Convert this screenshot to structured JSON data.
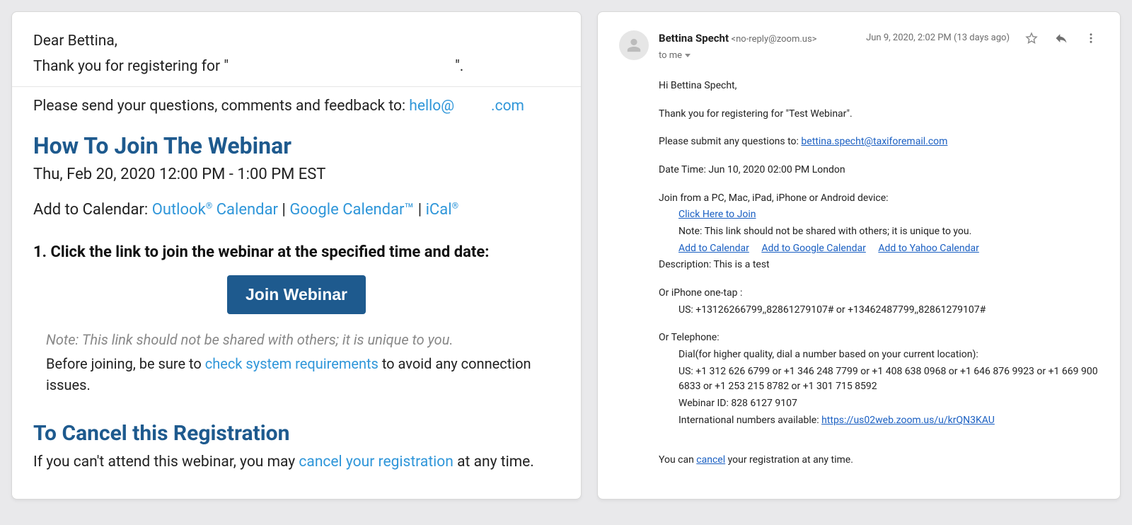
{
  "left": {
    "greeting": "Dear Bettina,",
    "thank_you_prefix": "Thank you for registering for \"",
    "thank_you_suffix": "\".",
    "feedback_label": "Please send your questions, comments and feedback to: ",
    "feedback_email_visible_prefix": "hello@",
    "feedback_email_visible_suffix": ".com",
    "section_join_title": "How To Join The Webinar",
    "datetime": "Thu, Feb 20, 2020 12:00 PM - 1:00 PM EST",
    "add_to_calendar_label": "Add to Calendar: ",
    "cal_outlook": "Outlook",
    "cal_outlook_suffix": " Calendar",
    "cal_sep": " | ",
    "cal_google": "Google Calendar™",
    "cal_ical": "iCal",
    "step1": "1. Click the link to join the webinar at the specified time and date:",
    "join_btn": "Join Webinar",
    "note": "Note: This link should not be shared with others; it is unique to you.",
    "before_prefix": "Before joining, be sure to ",
    "before_link": "check system requirements",
    "before_suffix": " to avoid any connection issues.",
    "section_cancel_title": "To Cancel this Registration",
    "cancel_prefix": "If you can't attend this webinar, you may ",
    "cancel_link": "cancel your registration",
    "cancel_suffix": " at any time."
  },
  "right": {
    "sender_name": "Bettina Specht",
    "sender_addr": "<no-reply@zoom.us>",
    "to_line": "to me",
    "date": "Jun 9, 2020, 2:02 PM (13 days ago)",
    "body": {
      "greeting": "Hi Bettina Specht,",
      "thank_you": "Thank you for registering for \"Test Webinar\".",
      "questions_label": "Please submit any questions to: ",
      "questions_email": "bettina.specht@taxiforemail.com",
      "datetime": "Date Time: Jun 10, 2020 02:00 PM London",
      "join_label": "Join from a PC, Mac, iPad, iPhone or Android device:",
      "click_here": "Click Here to Join",
      "note": "Note: This link should not be shared with others; it is unique to you.",
      "cal_add": "Add to Calendar",
      "cal_google": "Add to Google Calendar",
      "cal_yahoo": "Add to Yahoo Calendar",
      "description": "Description: This is a test",
      "iphone_label": "Or iPhone one-tap :",
      "iphone_numbers": "US: +13126266799,,82861279107# or +13462487799,,82861279107#",
      "tel_label": "Or Telephone:",
      "tel_dial": "Dial(for higher quality, dial a number based on your current location):",
      "tel_numbers": "US: +1 312 626 6799 or +1 346 248 7799 or +1 408 638 0968 or +1 646 876 9923 or +1 669 900 6833 or +1 253 215 8782 or +1 301 715 8592",
      "webinar_id": "Webinar ID: 828 6127 9107",
      "intl_label": "International numbers available: ",
      "intl_link": "https://us02web.zoom.us/u/krQN3KAU",
      "cancel_prefix": "You can ",
      "cancel_link": "cancel",
      "cancel_suffix": " your registration at any time."
    }
  }
}
